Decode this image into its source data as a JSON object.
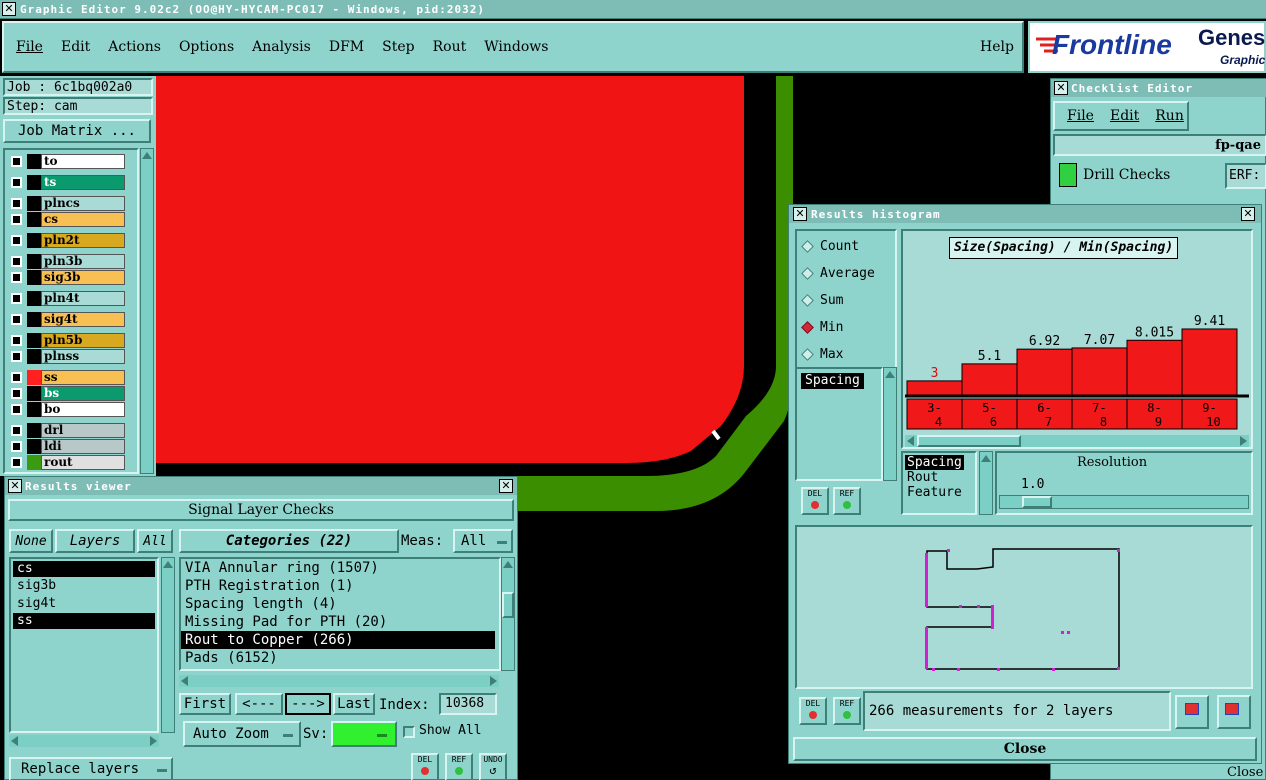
{
  "window": {
    "title": "Graphic Editor 9.02c2 (OO@HY-HYCAM-PC017 - Windows, pid:2032)"
  },
  "menubar": {
    "items": [
      "File",
      "Edit",
      "Actions",
      "Options",
      "Analysis",
      "DFM",
      "Step",
      "Rout",
      "Windows"
    ],
    "help": "Help"
  },
  "brand": {
    "logo": "Frontline",
    "product": "Genesi",
    "subtitle": "Graphic"
  },
  "job": {
    "job_label": "Job : 6c1bq002a0",
    "step_label": "Step: cam",
    "matrix_button": "Job Matrix ..."
  },
  "layers": [
    {
      "name": "to",
      "color": "#ffffff",
      "swatch": "#000000"
    },
    {
      "name": "ts",
      "color": "#0a9a6e",
      "swatch": "#000000"
    },
    {
      "name": "plncs",
      "color": "#a8dad6",
      "swatch": "#000000"
    },
    {
      "name": "cs",
      "color": "#f8c052",
      "swatch": "#000000"
    },
    {
      "name": "pln2t",
      "color": "#d8a820",
      "swatch": "#000000"
    },
    {
      "name": "pln3b",
      "color": "#a8dad6",
      "swatch": "#000000"
    },
    {
      "name": "sig3b",
      "color": "#f8c052",
      "swatch": "#000000"
    },
    {
      "name": "pln4t",
      "color": "#a8dad6",
      "swatch": "#000000"
    },
    {
      "name": "sig4t",
      "color": "#f8c052",
      "swatch": "#000000"
    },
    {
      "name": "pln5b",
      "color": "#d8a820",
      "swatch": "#000000"
    },
    {
      "name": "plnss",
      "color": "#a8dad6",
      "swatch": "#000000"
    },
    {
      "name": "ss",
      "color": "#f8c052",
      "swatch": "#ff2020"
    },
    {
      "name": "bs",
      "color": "#0a9a6e",
      "swatch": "#000000"
    },
    {
      "name": "bo",
      "color": "#ffffff",
      "swatch": "#000000"
    },
    {
      "name": "drl",
      "color": "#b8c8c8",
      "swatch": "#000000"
    },
    {
      "name": "ldi",
      "color": "#b8c8c8",
      "swatch": "#000000"
    },
    {
      "name": "rout",
      "color": "#e0e0e0",
      "swatch": "#3a9a10"
    }
  ],
  "checklist": {
    "title": "Checklist Editor",
    "menu": [
      "File",
      "Edit",
      "Run"
    ],
    "name": "fp-qae",
    "item": "Drill Checks",
    "erf": "ERF:",
    "close": "Close"
  },
  "results_viewer": {
    "title": "Results viewer",
    "header": "Signal Layer Checks",
    "none_btn": "None",
    "layers_btn": "Layers",
    "all_btn": "All",
    "categories_btn": "Categories (22)",
    "meas_label": "Meas:",
    "meas_value": "All",
    "layer_list": [
      "cs",
      "sig3b",
      "sig4t",
      "ss"
    ],
    "category_list": [
      "VIA Annular ring (1507)",
      "PTH Registration (1)",
      "Spacing length (4)",
      "Missing Pad for PTH (20)",
      "Rout to Copper (266)",
      "Pads (6152)"
    ],
    "first_btn": "First",
    "prev_btn": "<---",
    "next_btn": "--->",
    "last_btn": "Last",
    "index_label": "Index:",
    "index_value": "10368",
    "auto_zoom": "Auto Zoom",
    "sv_label": "Sv:",
    "show_all": "Show All",
    "replace_layers": "Replace layers",
    "del": "DEL",
    "ref": "REF",
    "undo": "UNDO"
  },
  "histogram": {
    "title": "Results histogram",
    "modes": [
      "Count",
      "Average",
      "Sum",
      "Min",
      "Max"
    ],
    "selected_mode": "Min",
    "chart_title": "Size(Spacing) / Min(Spacing)",
    "measure_list": [
      "Spacing"
    ],
    "sort_list": [
      "Spacing",
      "Rout",
      "Feature"
    ],
    "resolution_label": "Resolution",
    "resolution_value": "1.0",
    "status": "266 measurements for 2 layers",
    "close": "Close",
    "del": "DEL",
    "ref": "REF"
  },
  "chart_data": {
    "type": "bar",
    "title": "Size(Spacing) / Min(Spacing)",
    "categories": [
      "3-4",
      "5-6",
      "6-7",
      "7-8",
      "8-9",
      "9-10"
    ],
    "category_top": [
      "3-",
      "5-",
      "6-",
      "7-",
      "8-",
      "9-"
    ],
    "category_bottom": [
      "4",
      "6",
      "7",
      "8",
      "9",
      "10"
    ],
    "values": [
      3,
      5.1,
      6.92,
      7.07,
      8.015,
      9.41
    ],
    "value_labels": [
      "3",
      "5.1",
      "6.92",
      "7.07",
      "8.015",
      "9.41"
    ],
    "ylim": [
      0,
      10
    ],
    "colors": {
      "bar": "#f01818",
      "bg": "#a8dad6",
      "first_label": "#d01010"
    }
  },
  "colors": {
    "teal": "#8fd4cc",
    "copper": "#f01414",
    "rout": "#3a8e00"
  }
}
